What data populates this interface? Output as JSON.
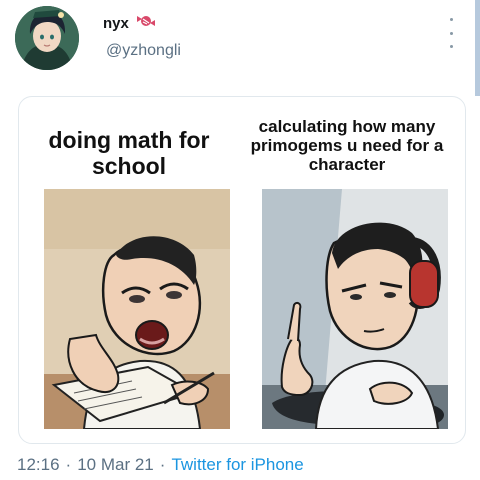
{
  "tweet": {
    "display_name": "nyx",
    "handle": "@yzhongli",
    "timestamp_time": "12:16",
    "timestamp_date": "10 Mar 21",
    "client": "Twitter for iPhone",
    "separator": "·"
  },
  "meme": {
    "left_caption": "doing math for school",
    "right_caption": "calculating how many primogems u need for a character"
  },
  "icons": {
    "name_badge": "candy-icon",
    "more": "more-vertical-icon"
  },
  "colors": {
    "text_primary": "#14171a",
    "text_secondary": "#5b7083",
    "link": "#1b95e0",
    "badge": "#d9496a"
  }
}
